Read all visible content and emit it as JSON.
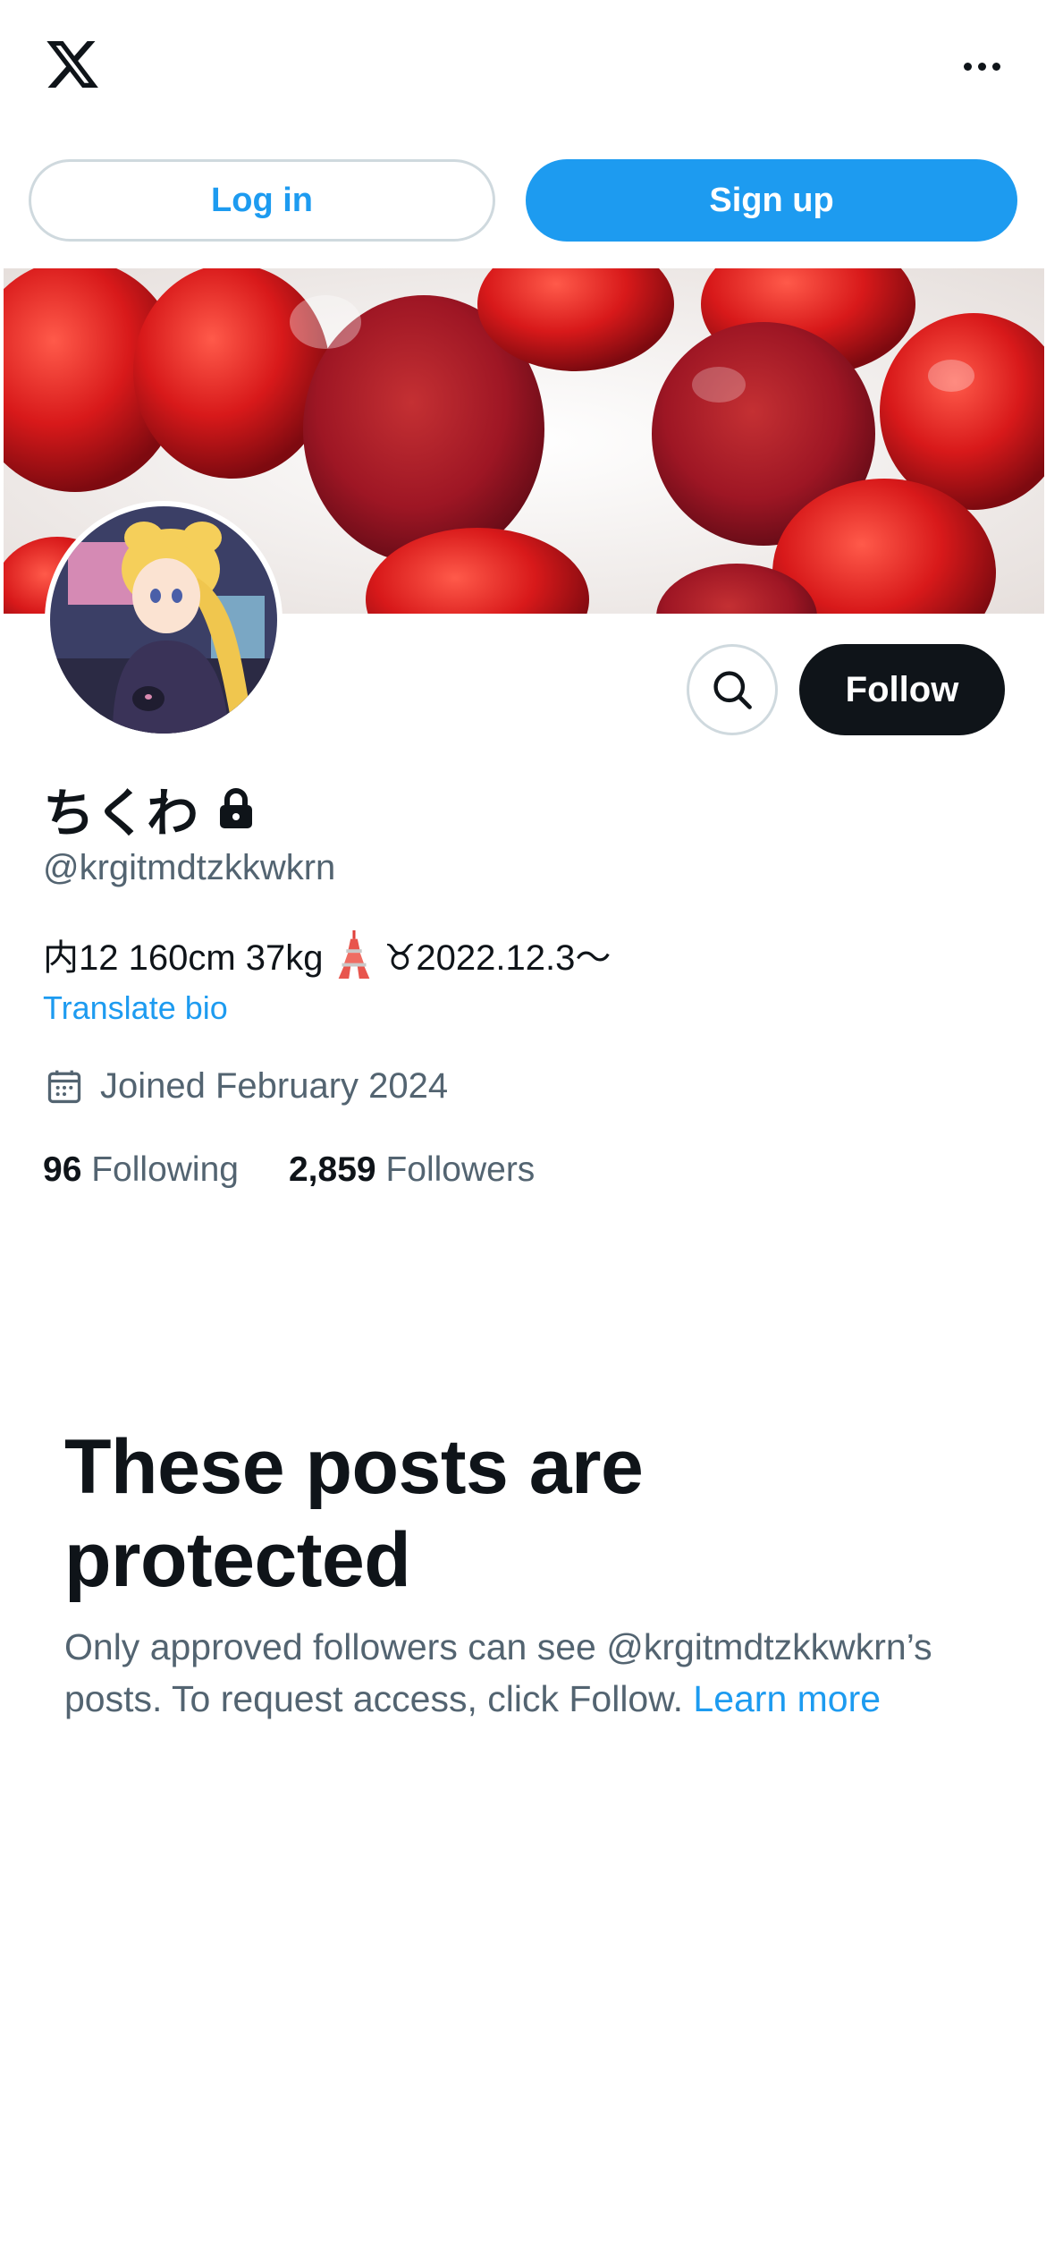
{
  "header": {
    "logo_icon": "x-logo-icon",
    "more_icon": "more-options-icon"
  },
  "auth": {
    "login_label": "Log in",
    "signup_label": "Sign up"
  },
  "profile": {
    "display_name": "ちくわ",
    "protected_icon": "lock-icon",
    "handle": "@krgitmdtzkkwkrn",
    "bio_prefix": "内12 160cm 37kg",
    "bio_suffix": "♉︎2022.12.3〜",
    "translate_bio": "Translate bio",
    "joined": "Joined February 2024",
    "following_count": "96",
    "following_label": "Following",
    "followers_count": "2,859",
    "followers_label": "Followers"
  },
  "actions": {
    "search_icon": "search-icon",
    "follow_label": "Follow"
  },
  "protected": {
    "title": "These posts are protected",
    "description": "Only approved followers can see @krgitmdtzkkwkrn’s posts. To request access, click Follow.",
    "learn_more": "Learn more"
  },
  "colors": {
    "accent": "#1d9bf0",
    "text_primary": "#0f1419",
    "text_secondary": "#536471",
    "border": "#cfd9de"
  }
}
